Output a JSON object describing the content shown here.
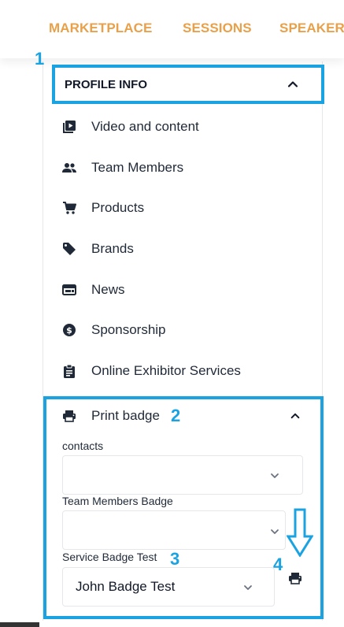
{
  "nav": {
    "items": [
      "MARKETPLACE",
      "SESSIONS",
      "SPEAKERS"
    ],
    "color": "#e8a14a"
  },
  "annotations": [
    "1",
    "2",
    "3",
    "4"
  ],
  "profile": {
    "header": "PROFILE INFO",
    "items": [
      {
        "label": "Video and content",
        "icon": "video-library-icon"
      },
      {
        "label": "Team Members",
        "icon": "people-icon"
      },
      {
        "label": "Products",
        "icon": "shopping-cart-icon"
      },
      {
        "label": "Brands",
        "icon": "tag-icon"
      },
      {
        "label": "News",
        "icon": "news-icon"
      },
      {
        "label": "Sponsorship",
        "icon": "dollar-circle-icon"
      },
      {
        "label": "Online Exhibitor Services",
        "icon": "clipboard-icon"
      }
    ]
  },
  "print": {
    "header": "Print badge",
    "fields": [
      {
        "label": "contacts",
        "value": ""
      },
      {
        "label": "Team Members Badge",
        "value": ""
      },
      {
        "label": "Service Badge Test",
        "value": "John Badge Test"
      }
    ]
  },
  "colors": {
    "highlight": "#1aa3e0",
    "accent": "#e8a14a"
  }
}
